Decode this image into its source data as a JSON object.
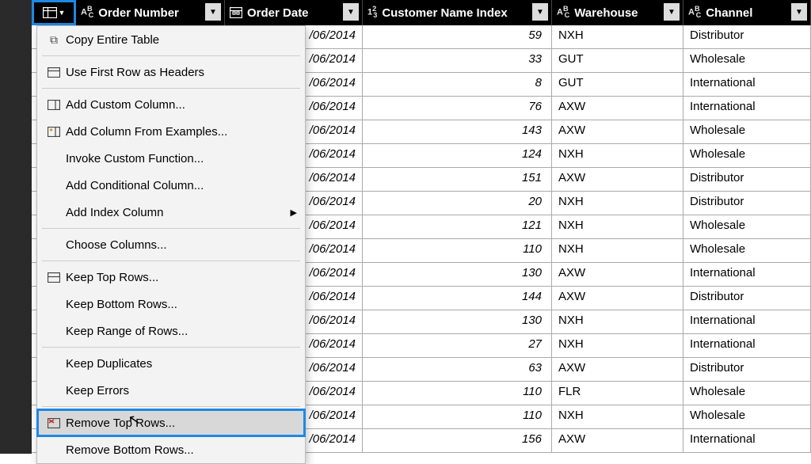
{
  "columns": {
    "order_number": "Order Number",
    "order_date": "Order Date",
    "customer_name_index": "Customer Name Index",
    "warehouse": "Warehouse",
    "channel": "Channel"
  },
  "type_prefix": {
    "abc": "ABC",
    "num": "1²3",
    "date": ""
  },
  "menu": {
    "copy_entire_table": "Copy Entire Table",
    "use_first_row_headers": "Use First Row as Headers",
    "add_custom_column": "Add Custom Column...",
    "add_column_examples": "Add Column From Examples...",
    "invoke_custom_function": "Invoke Custom Function...",
    "add_conditional_column": "Add Conditional Column...",
    "add_index_column": "Add Index Column",
    "choose_columns": "Choose Columns...",
    "keep_top_rows": "Keep Top Rows...",
    "keep_bottom_rows": "Keep Bottom Rows...",
    "keep_range_rows": "Keep Range of Rows...",
    "keep_duplicates": "Keep Duplicates",
    "keep_errors": "Keep Errors",
    "remove_top_rows": "Remove Top Rows...",
    "remove_bottom_rows": "Remove Bottom Rows..."
  },
  "rows": [
    {
      "date": "/06/2014",
      "idx": 59,
      "wh": "NXH",
      "ch": "Distributor"
    },
    {
      "date": "/06/2014",
      "idx": 33,
      "wh": "GUT",
      "ch": "Wholesale"
    },
    {
      "date": "/06/2014",
      "idx": 8,
      "wh": "GUT",
      "ch": "International"
    },
    {
      "date": "/06/2014",
      "idx": 76,
      "wh": "AXW",
      "ch": "International"
    },
    {
      "date": "/06/2014",
      "idx": 143,
      "wh": "AXW",
      "ch": "Wholesale"
    },
    {
      "date": "/06/2014",
      "idx": 124,
      "wh": "NXH",
      "ch": "Wholesale"
    },
    {
      "date": "/06/2014",
      "idx": 151,
      "wh": "AXW",
      "ch": "Distributor"
    },
    {
      "date": "/06/2014",
      "idx": 20,
      "wh": "NXH",
      "ch": "Distributor"
    },
    {
      "date": "/06/2014",
      "idx": 121,
      "wh": "NXH",
      "ch": "Wholesale"
    },
    {
      "date": "/06/2014",
      "idx": 110,
      "wh": "NXH",
      "ch": "Wholesale"
    },
    {
      "date": "/06/2014",
      "idx": 130,
      "wh": "AXW",
      "ch": "International"
    },
    {
      "date": "/06/2014",
      "idx": 144,
      "wh": "AXW",
      "ch": "Distributor"
    },
    {
      "date": "/06/2014",
      "idx": 130,
      "wh": "NXH",
      "ch": "International"
    },
    {
      "date": "/06/2014",
      "idx": 27,
      "wh": "NXH",
      "ch": "International"
    },
    {
      "date": "/06/2014",
      "idx": 63,
      "wh": "AXW",
      "ch": "Distributor"
    },
    {
      "date": "/06/2014",
      "idx": 110,
      "wh": "FLR",
      "ch": "Wholesale"
    },
    {
      "date": "/06/2014",
      "idx": 110,
      "wh": "NXH",
      "ch": "Wholesale"
    },
    {
      "date": "/06/2014",
      "idx": 156,
      "wh": "AXW",
      "ch": "International"
    }
  ]
}
